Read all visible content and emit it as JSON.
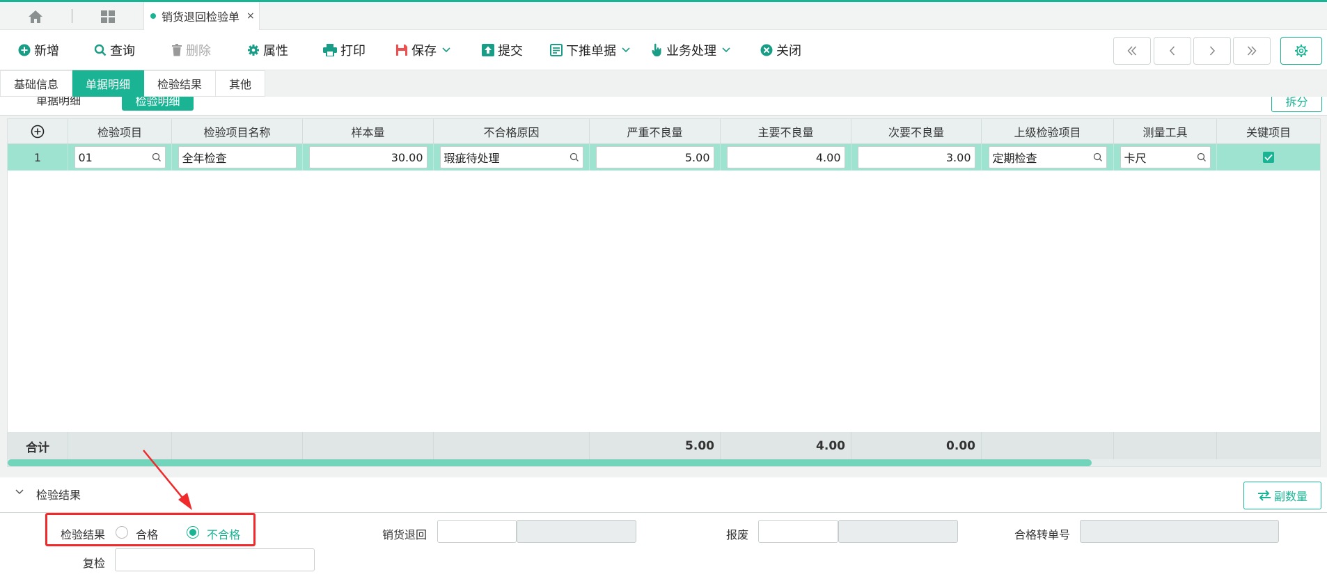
{
  "tabbar": {
    "doc_tab_title": "销货退回检验单",
    "close_glyph": "×"
  },
  "toolbar": {
    "add": "新增",
    "query": "查询",
    "delete": "删除",
    "props": "属性",
    "print": "打印",
    "save": "保存",
    "submit": "提交",
    "push": "下推单据",
    "business": "业务处理",
    "close": "关闭"
  },
  "subtabs": [
    "基础信息",
    "单据明细",
    "检验结果",
    "其他"
  ],
  "detail_section": {
    "label": "单据明细",
    "ghost_button": "检验明细",
    "split_button": "拆分"
  },
  "grid": {
    "headers": [
      "检验项目",
      "检验项目名称",
      "样本量",
      "不合格原因",
      "严重不良量",
      "主要不良量",
      "次要不良量",
      "上级检验项目",
      "测量工具",
      "关键项目"
    ],
    "rows": [
      {
        "no": "1",
        "item": "01",
        "name": "全年检查",
        "sample": "30.00",
        "reason": "瑕疵待处理",
        "severe": "5.00",
        "major": "4.00",
        "minor": "3.00",
        "parent": "定期检查",
        "tool": "卡尺",
        "key": true
      }
    ],
    "footer": {
      "label": "合计",
      "severe": "5.00",
      "major": "4.00",
      "minor": "0.00"
    }
  },
  "result_section": {
    "label": "检验结果",
    "vice_button": "副数量"
  },
  "form": {
    "result_label": "检验结果",
    "opt_pass": "合格",
    "opt_fail": "不合格",
    "selected": "不合格",
    "return_label": "销货退回",
    "scrap_label": "报废",
    "pass_no_label": "合格转单号",
    "recheck_label": "复检"
  },
  "colors": {
    "accent": "#1ab394",
    "row_highlight": "#9de3cf",
    "annotation": "#f02a2a"
  },
  "icons": [
    "home-icon",
    "apps-icon",
    "add-icon",
    "search-icon",
    "trash-icon",
    "gear-icon",
    "print-icon",
    "save-icon",
    "upload-icon",
    "document-icon",
    "hand-pointer-icon",
    "close-circle-icon",
    "chevron-double-left-icon",
    "chevron-left-icon",
    "chevron-right-icon",
    "chevron-double-right-icon",
    "add-circle-icon",
    "check-icon",
    "swap-icon",
    "chevron-down-icon"
  ]
}
